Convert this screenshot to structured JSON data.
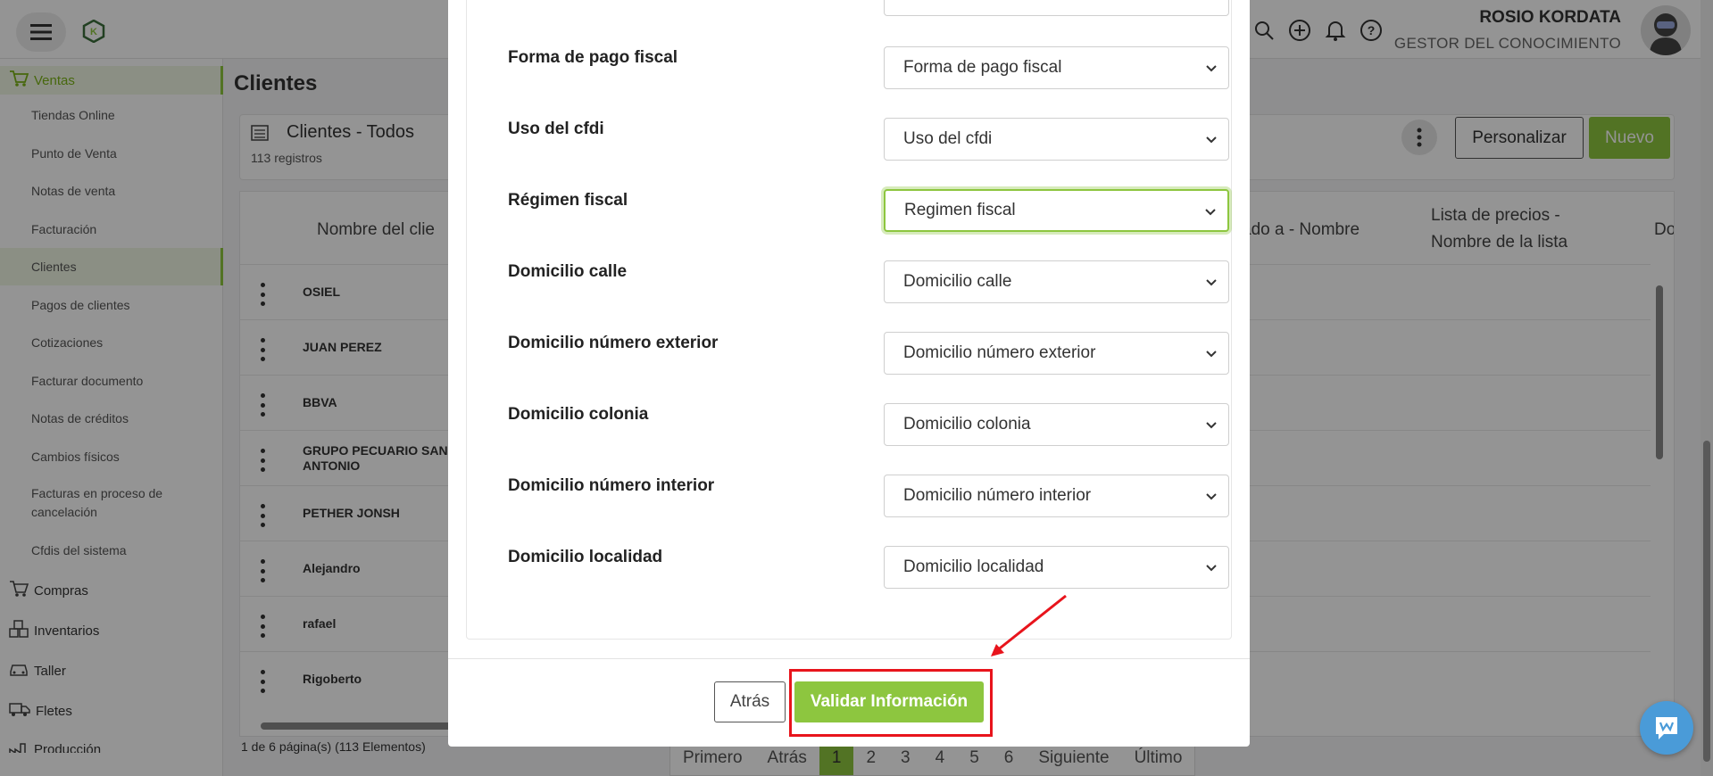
{
  "header": {
    "user_name": "ROSIO KORDATA",
    "user_role": "GESTOR DEL CONOCIMIENTO",
    "icons": [
      "search-icon",
      "plus-circle-icon",
      "bell-icon",
      "help-icon"
    ]
  },
  "sidebar": {
    "section_ventas": "Ventas",
    "items": [
      "Tiendas Online",
      "Punto de Venta",
      "Notas de venta",
      "Facturación",
      "Clientes",
      "Pagos de clientes",
      "Cotizaciones",
      "Facturar documento",
      "Notas de créditos",
      "Cambios físicos",
      "Facturas en proceso de cancelación",
      "Cfdis del sistema"
    ],
    "sections": [
      "Compras",
      "Inventarios",
      "Taller",
      "Fletes",
      "Producción"
    ]
  },
  "main": {
    "title": "Clientes",
    "list_title": "Clientes - Todos",
    "record_count": "113 registros",
    "btn_personalizar": "Personalizar",
    "btn_nuevo": "Nuevo",
    "columns": [
      "Nombre del clie",
      "ado a - Nombre",
      "Lista de precios - Nombre de la lista",
      "Do"
    ],
    "rows": [
      "OSIEL",
      "JUAN PEREZ",
      "BBVA",
      "GRUPO PECUARIO SAN ANTONIO",
      "PETHER JONSH",
      "Alejandro",
      "rafael",
      "Rigoberto"
    ],
    "paging_info": "1 de 6 página(s) (113 Elementos)",
    "pager": [
      "Primero",
      "Atrás",
      "1",
      "2",
      "3",
      "4",
      "5",
      "6",
      "Siguiente",
      "Último"
    ],
    "current_page": "1"
  },
  "modal": {
    "fields": [
      {
        "label": "Forma de pago fiscal",
        "value": "Forma de pago fiscal"
      },
      {
        "label": "Uso del cfdi",
        "value": "Uso del cfdi"
      },
      {
        "label": "Régimen fiscal",
        "value": "Regimen fiscal"
      },
      {
        "label": "Domicilio calle",
        "value": "Domicilio calle"
      },
      {
        "label": "Domicilio número exterior",
        "value": "Domicilio número exterior"
      },
      {
        "label": "Domicilio colonia",
        "value": "Domicilio colonia"
      },
      {
        "label": "Domicilio número interior",
        "value": "Domicilio número interior"
      },
      {
        "label": "Domicilio localidad",
        "value": "Domicilio localidad"
      }
    ],
    "btn_back": "Atrás",
    "btn_validate": "Validar Información"
  },
  "colors": {
    "accent": "#8dc63f",
    "annotation": "#e8141c"
  }
}
